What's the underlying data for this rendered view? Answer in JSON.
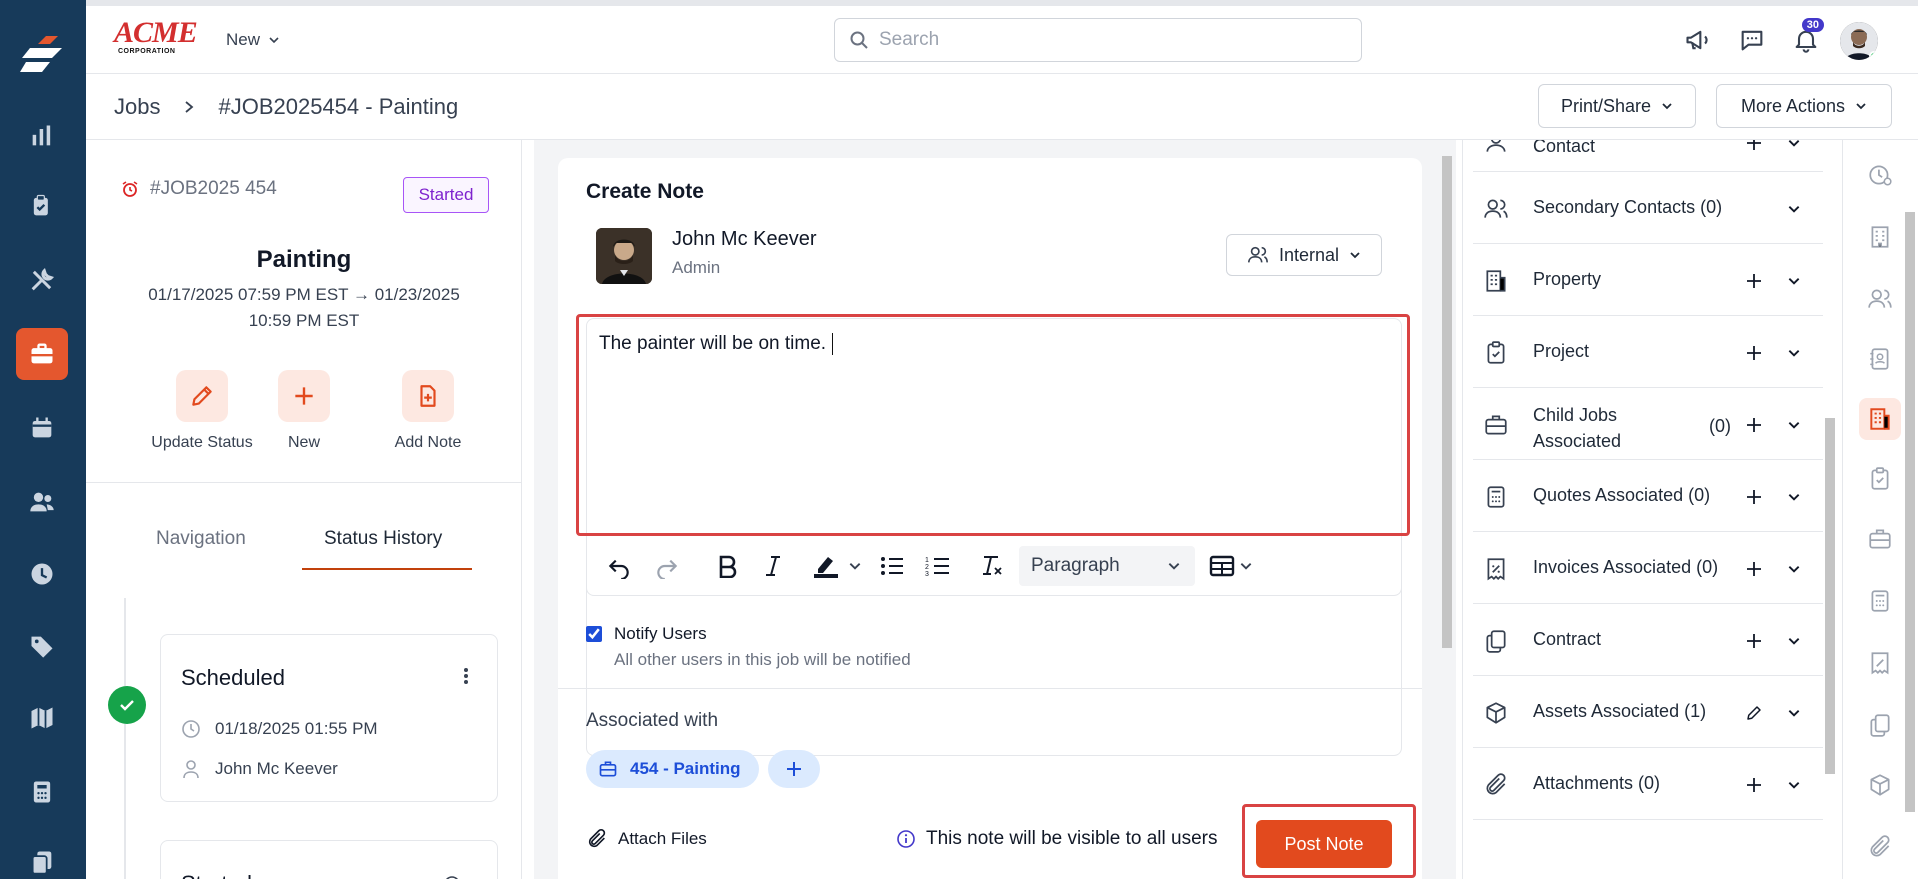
{
  "brand": {
    "logo_text": "ACME",
    "logo_sub": "CORPORATION"
  },
  "topbar": {
    "new_label": "New",
    "search_placeholder": "Search",
    "notification_count": "30"
  },
  "breadcrumb": {
    "root": "Jobs",
    "current": "#JOB2025454 - Painting"
  },
  "header_actions": {
    "print_share": "Print/Share",
    "more_actions": "More Actions"
  },
  "job": {
    "id": "#JOB2025 454",
    "status": "Started",
    "title": "Painting",
    "dates": "01/17/2025 07:59 PM EST → 01/23/2025 10:59 PM EST",
    "quick_actions": [
      {
        "label": "Update Status",
        "icon": "pencil-icon"
      },
      {
        "label": "New",
        "icon": "plus-icon"
      },
      {
        "label": "Add Note",
        "icon": "file-plus-icon"
      }
    ],
    "tabs": [
      {
        "label": "Navigation",
        "active": false
      },
      {
        "label": "Status History",
        "active": true
      }
    ],
    "history": [
      {
        "status": "Scheduled",
        "datetime": "01/18/2025 01:55 PM",
        "user": "John Mc Keever"
      },
      {
        "status": "Started"
      }
    ]
  },
  "note": {
    "title": "Create Note",
    "author_name": "John Mc Keever",
    "author_role": "Admin",
    "visibility": "Internal",
    "body": "The painter will be on time.",
    "toolbar": {
      "block_format": "Paragraph"
    },
    "notify_label": "Notify Users",
    "notify_checked": true,
    "notify_sub": "All other users in this job will be notified",
    "associated_title": "Associated with",
    "associated_chip": "454 - Painting",
    "attach_label": "Attach Files",
    "visibility_note": "This note will be visible to all users",
    "post_label": "Post Note"
  },
  "associations": [
    {
      "label": "Contact",
      "partial": true
    },
    {
      "label": "Secondary Contacts (0)",
      "icon": "users-icon",
      "action": "none"
    },
    {
      "label": "Property",
      "icon": "building-icon",
      "action": "add"
    },
    {
      "label": "Project",
      "icon": "clipboard-check-icon",
      "action": "add"
    },
    {
      "label": "Child Jobs Associated",
      "count": "(0)",
      "icon": "briefcase-icon",
      "action": "add"
    },
    {
      "label": "Quotes Associated (0)",
      "icon": "calculator-icon",
      "action": "add"
    },
    {
      "label": "Invoices Associated (0)",
      "icon": "invoice-percent-icon",
      "action": "add"
    },
    {
      "label": "Contract",
      "icon": "copy-icon",
      "action": "add"
    },
    {
      "label": "Assets Associated (1)",
      "icon": "box-icon",
      "action": "edit"
    },
    {
      "label": "Attachments (0)",
      "icon": "paperclip-icon",
      "action": "add"
    }
  ],
  "colors": {
    "accent": "#e24a1e",
    "rail": "#173a5a",
    "highlight_box": "#d94343",
    "chip_bg": "#dbeafe"
  }
}
